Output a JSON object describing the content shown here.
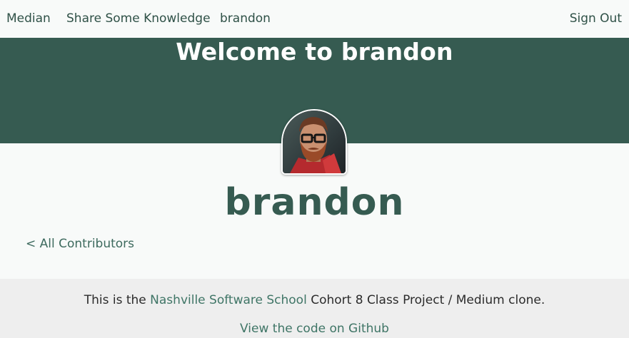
{
  "nav": {
    "brand": "Median",
    "share": "Share Some Knowledge",
    "user": "brandon",
    "sign_out": "Sign Out"
  },
  "hero": {
    "title": "Welcome to brandon"
  },
  "profile": {
    "name": "brandon",
    "back_link": "< All Contributors"
  },
  "footer": {
    "prefix": "This is the ",
    "school_link": "Nashville Software School",
    "suffix": " Cohort 8 Class Project / Medium clone.",
    "github_link": "View the code on Github"
  },
  "colors": {
    "brand_green": "#365b51",
    "link_green": "#3f7566",
    "footer_bg": "#eeeeee"
  }
}
